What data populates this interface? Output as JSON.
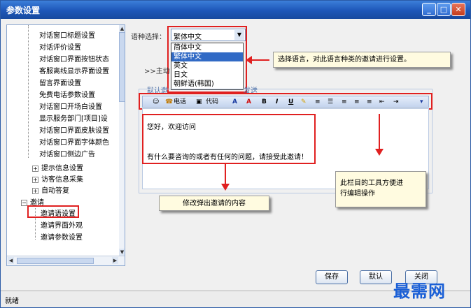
{
  "window": {
    "title": "参数设置",
    "minimize": "_",
    "maximize": "□",
    "close": "✕"
  },
  "tree": {
    "items": [
      "对话窗口标题设置",
      "对话评价设置",
      "对话窗口界面按钮状态",
      "客服离线显示界面设置",
      "留言界面设置",
      "免费电话参数设置",
      "对话窗口开场白设置",
      "显示服务部门[项目]设",
      "对话窗口界面皮肤设置",
      "对话窗口界面字体颜色",
      "对话窗口侧边广告"
    ],
    "groups": [
      "提示信息设置",
      "访客信息采集",
      "自动答复"
    ],
    "invite_group": "邀请",
    "invite_items": [
      "邀请语设置",
      "邀请界面外观",
      "邀请参数设置"
    ]
  },
  "language": {
    "label": "语种选择：",
    "selected": "繁体中文",
    "options": [
      "简体中文",
      "繁体中文",
      "英文",
      "日文",
      "朝鲜语(韩国)"
    ]
  },
  "main": {
    "crumb": ">>主动",
    "default_label": "默认邀",
    "tab_hint": "发送"
  },
  "toolbar": {
    "phone": "电话",
    "code": "代码",
    "bold": "B",
    "italic": "I",
    "underline": "U"
  },
  "editor": {
    "line1": "您好，欢迎访问",
    "line2": "有什么要咨询的或者有任何的问题，请接受此邀请！"
  },
  "callouts": {
    "language": "选择语言，对此语言种类的邀请进行设置。",
    "editor": "修改弹出邀请的内容",
    "toolbar_1": "此栏目的工具方便进",
    "toolbar_2": "行编辑操作"
  },
  "buttons": {
    "save": "保存",
    "default": "默认",
    "close": "关闭"
  },
  "status": "就绪",
  "watermark": "最需网"
}
